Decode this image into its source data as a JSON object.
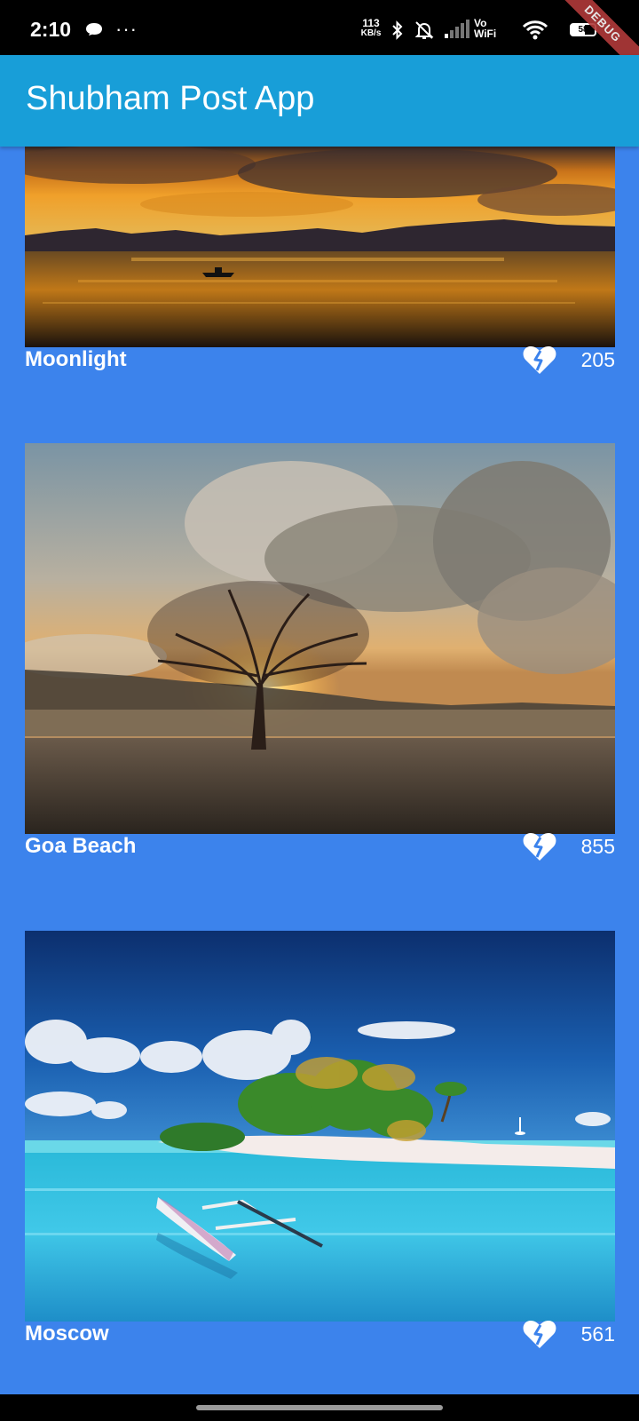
{
  "status_bar": {
    "time": "2:10",
    "dots": "···",
    "net_speed_value": "113",
    "net_speed_unit": "KB/s",
    "vowifi_top": "Vo",
    "vowifi_bottom": "WiFi",
    "battery_level": "58",
    "debug_banner": "DEBUG"
  },
  "app_bar": {
    "title": "Shubham Post App"
  },
  "posts": [
    {
      "title": "Moonlight",
      "likes": "205"
    },
    {
      "title": "Goa Beach",
      "likes": "855"
    },
    {
      "title": "Moscow",
      "likes": "561"
    }
  ],
  "colors": {
    "app_bar": "#189ed8",
    "content_background": "#3c83ec",
    "text": "#ffffff"
  },
  "icons": {
    "like": "broken-heart-icon",
    "chat": "chat-bubble-icon"
  }
}
